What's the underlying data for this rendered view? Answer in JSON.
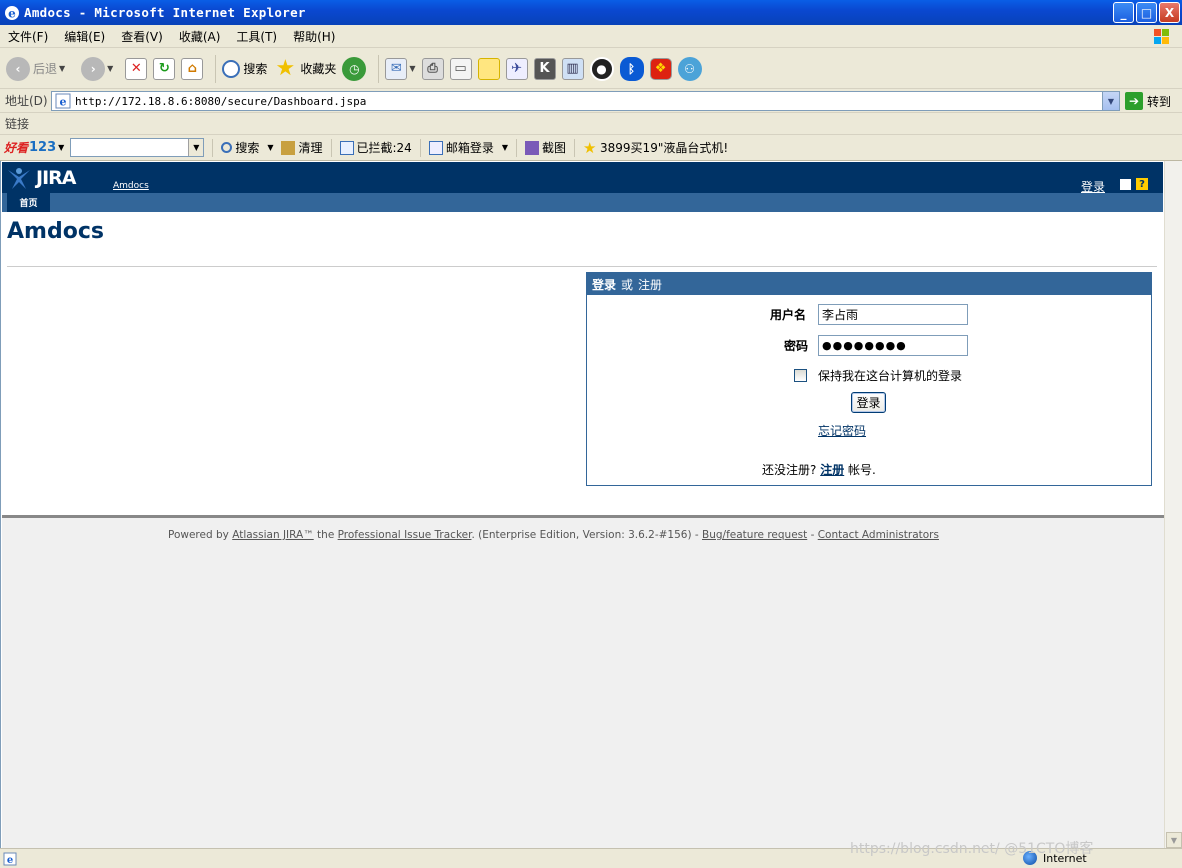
{
  "window": {
    "title": "Amdocs - Microsoft Internet Explorer",
    "buttons": [
      "_",
      "□",
      "X"
    ]
  },
  "menu": [
    "文件(F)",
    "编辑(E)",
    "查看(V)",
    "收藏(A)",
    "工具(T)",
    "帮助(H)"
  ],
  "toolbar": {
    "back_label": "后退",
    "search_label": "搜索",
    "favorites_label": "收藏夹"
  },
  "address": {
    "label": "地址(D)",
    "url": "http://172.18.8.6:8080/secure/Dashboard.jspa",
    "go_label": "转到"
  },
  "links_bar": {
    "label": "链接"
  },
  "hao123": {
    "logo_hk": "好看",
    "logo_num": "123",
    "search_label": "搜索",
    "clean_label": "清理",
    "blocked_label": "已拦截:24",
    "mail_label": "邮箱登录",
    "screenshot_label": "截图",
    "ad_label": "3899买19\"液晶台式机!"
  },
  "jira": {
    "logo_text": "JIRA",
    "project_link": "Amdocs",
    "login_link": "登录",
    "help_glyph": "?",
    "home_tab": "首页",
    "page_title": "Amdocs"
  },
  "login": {
    "header_login": "登录",
    "header_or": "或",
    "header_register": "注册",
    "username_label": "用户名",
    "username_value": "李占雨",
    "password_label": "密码",
    "password_value": "●●●●●●●●",
    "remember_label": "保持我在这台计算机的登录",
    "remember_checked": false,
    "submit_label": "登录",
    "forgot_label": "忘记密码",
    "no_account_prefix": "还没注册?",
    "register_link": "注册",
    "no_account_suffix": "帐号."
  },
  "footer": {
    "powered_by": "Powered by ",
    "atlassian_link": "Atlassian JIRA™",
    "the": " the ",
    "tracker_link": "Professional Issue Tracker",
    "edition": ". (Enterprise Edition, Version: 3.6.2-#156) - ",
    "bug_link": "Bug/feature request",
    "dash": " - ",
    "contact_link": "Contact Administrators"
  },
  "status": {
    "zone": "Internet",
    "watermark": "https://blog.csdn.net/ @51CTO博客"
  },
  "colors": {
    "jira_dark": "#003366",
    "jira_nav": "#336699",
    "xp_title": "#0a48d1"
  }
}
